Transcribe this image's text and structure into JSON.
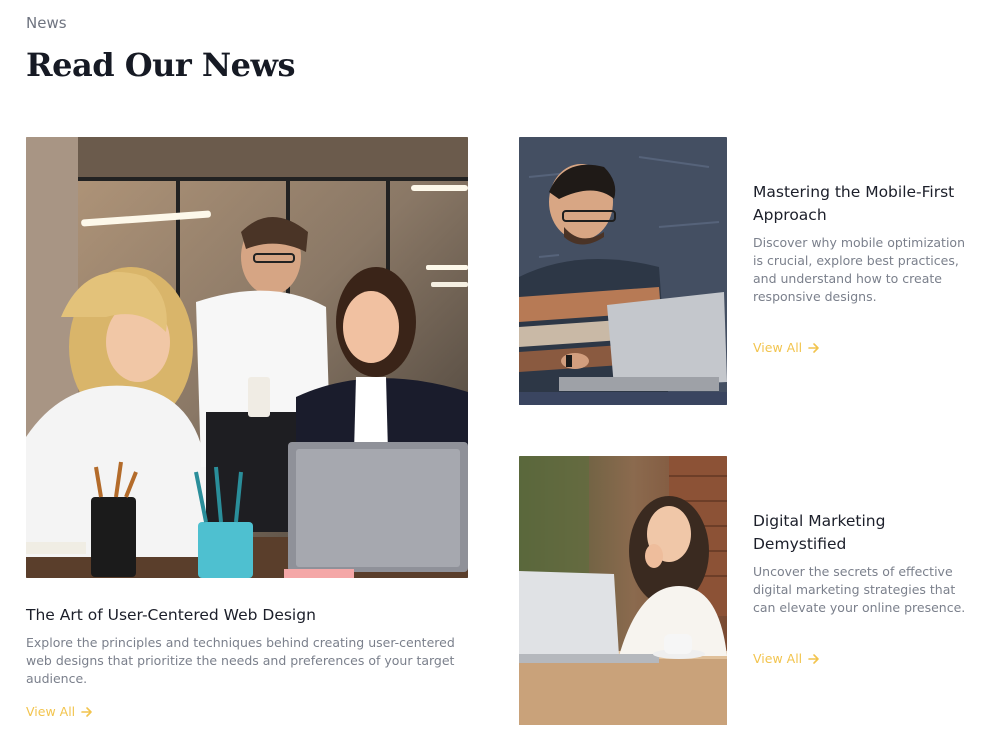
{
  "section": {
    "eyebrow": "News",
    "heading": "Read Our News"
  },
  "colors": {
    "accent": "#F2C44E",
    "heading": "#161A24",
    "muted_text": "#7B808C"
  },
  "articles": [
    {
      "title": "The Art of User-Centered Web Design",
      "description": "Explore the principles and techniques behind creating user-centered web designs that prioritize the needs and preferences of your target audience.",
      "cta": "View All",
      "image_icon": "office-team-photo"
    },
    {
      "title": "Mastering the Mobile-First Approach",
      "description": "Discover why mobile optimization is crucial, explore best practices, and understand how to create responsive designs.",
      "cta": "View All",
      "image_icon": "man-with-laptop-photo"
    },
    {
      "title": "Digital Marketing Demystified",
      "description": "Uncover the secrets of effective digital marketing strategies that can elevate your online presence.",
      "cta": "View All",
      "image_icon": "woman-with-laptop-photo"
    }
  ]
}
